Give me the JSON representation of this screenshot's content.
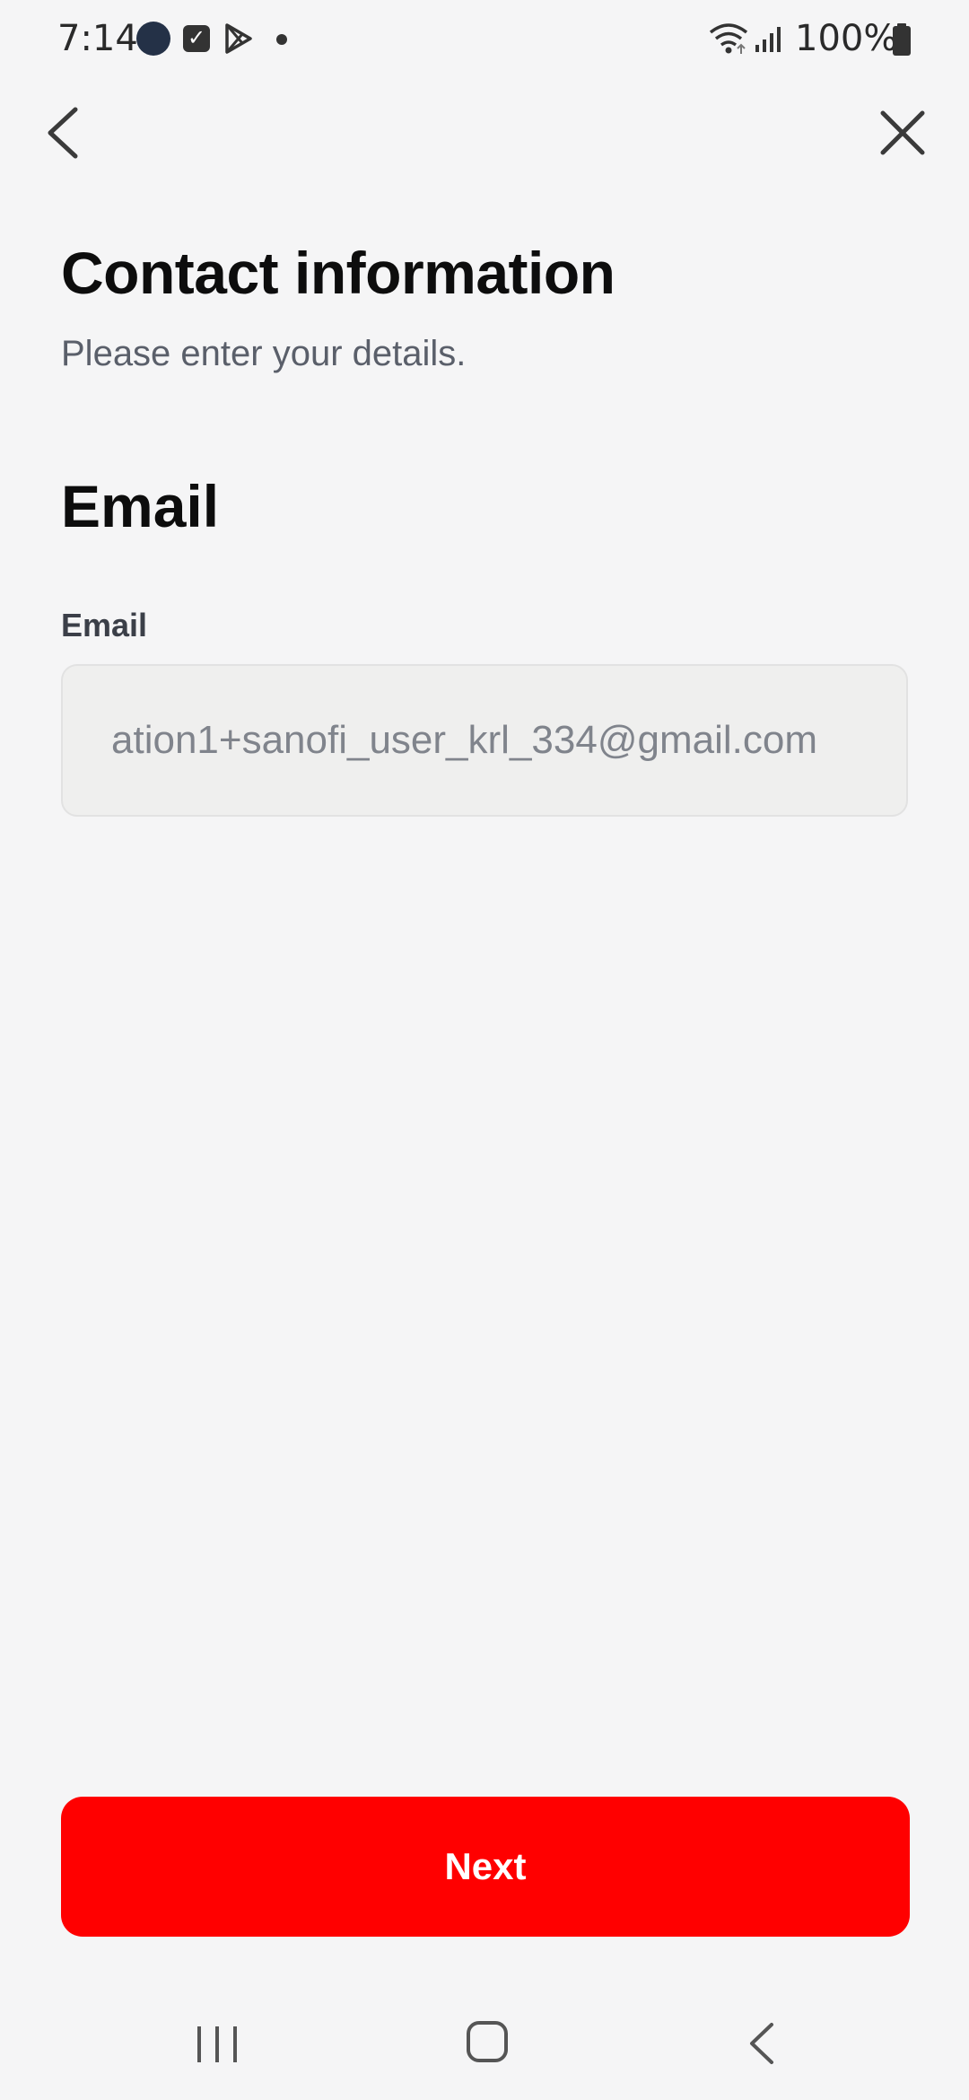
{
  "status_bar": {
    "time": "7:14",
    "battery": "100%",
    "icons": [
      "moon-icon",
      "checkbox-icon",
      "play-store-icon",
      "notification-dot",
      "wifi-icon",
      "signal-icon",
      "battery-icon"
    ]
  },
  "nav": {
    "back_icon": "chevron-left-icon",
    "close_icon": "close-icon"
  },
  "header": {
    "title": "Contact information",
    "subtitle": "Please enter your details."
  },
  "section": {
    "title": "Email"
  },
  "email_field": {
    "label": "Email",
    "value": "ation1+sanofi_user_krl_334@gmail.com"
  },
  "actions": {
    "next_label": "Next"
  },
  "colors": {
    "background": "#f5f5f6",
    "primary_button": "#ff0000",
    "field_background": "#efefee",
    "title_text": "#0d0d0d",
    "subtitle_text": "#5a5f6a"
  },
  "system_nav": {
    "icons": [
      "recents-icon",
      "home-icon",
      "back-icon"
    ]
  }
}
